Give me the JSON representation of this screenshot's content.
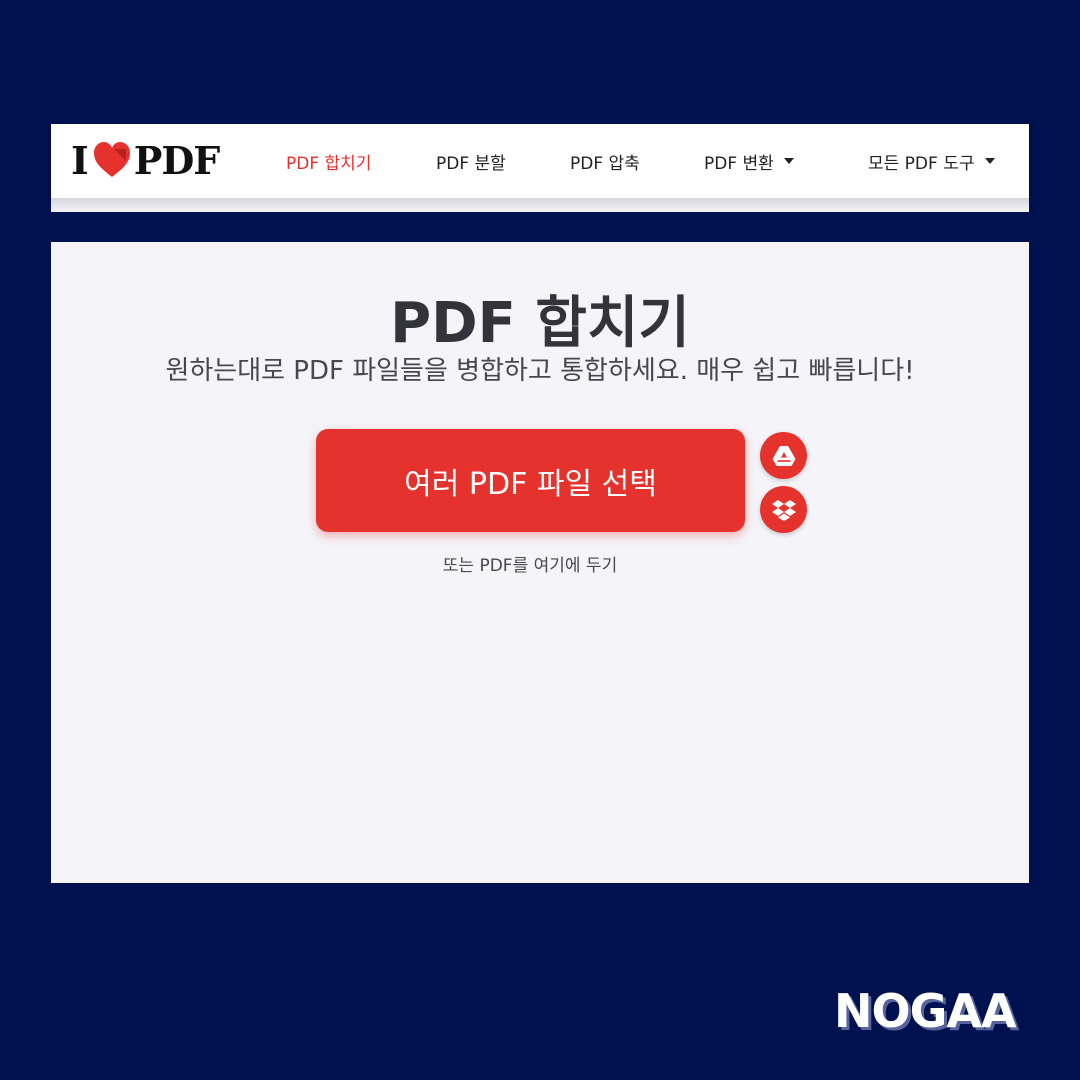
{
  "nav": {
    "logo": {
      "prefix": "I",
      "suffix": "PDF",
      "heart_color": "#e5322d"
    },
    "items": [
      {
        "label": "PDF 합치기",
        "active": true,
        "dropdown": false
      },
      {
        "label": "PDF 분할",
        "active": false,
        "dropdown": false
      },
      {
        "label": "PDF 압축",
        "active": false,
        "dropdown": false
      },
      {
        "label": "PDF 변환",
        "active": false,
        "dropdown": true
      },
      {
        "label": "모든 PDF 도구",
        "active": false,
        "dropdown": true
      }
    ]
  },
  "main": {
    "title": "PDF 합치기",
    "subtitle": "원하는대로 PDF 파일들을 병합하고 통합하세요. 매우 쉽고 빠릅니다!",
    "select_button": "여러 PDF 파일 선택",
    "cloud_buttons": [
      {
        "icon": "google-drive-icon"
      },
      {
        "icon": "dropbox-icon"
      }
    ],
    "drop_hint": "또는 PDF를 여기에 두기"
  },
  "watermark": "NOGAA",
  "colors": {
    "background": "#001150",
    "accent": "#e5322d",
    "card": "#f4f4f9",
    "text": "#33333b"
  }
}
